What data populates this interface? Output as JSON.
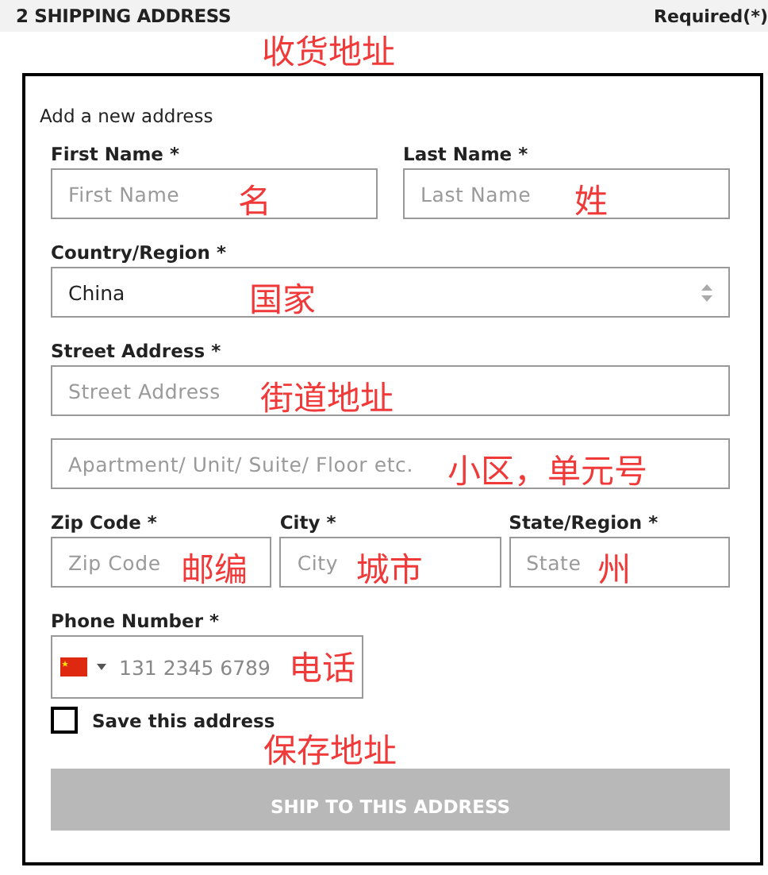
{
  "header": {
    "title": "2 SHIPPING ADDRESS",
    "required_note": "Required(*)"
  },
  "heading_note": "收货地址",
  "form": {
    "title": "Add a new address",
    "rows": [
      [
        {
          "kind": "text",
          "label": "First Name *",
          "placeholder": "First Name",
          "note": "名"
        },
        {
          "kind": "text",
          "label": "Last Name *",
          "placeholder": "Last Name",
          "note": "姓"
        }
      ],
      [
        {
          "kind": "select",
          "label": "Country/Region *",
          "value": "China",
          "note": "国家"
        }
      ],
      [
        {
          "kind": "text",
          "label": "Street Address *",
          "placeholder": "Street Address",
          "note": "街道地址"
        }
      ],
      [
        {
          "kind": "text",
          "placeholder": "Apartment/ Unit/ Suite/ Floor etc.",
          "note": "小区，单元号"
        }
      ],
      [
        {
          "kind": "text",
          "label": "Zip Code *",
          "placeholder": "Zip Code",
          "note": "邮编"
        },
        {
          "kind": "text",
          "label": "City *",
          "placeholder": "City",
          "note": "城市"
        },
        {
          "kind": "text",
          "label": "State/Region *",
          "placeholder": "State",
          "note": "州"
        }
      ],
      [
        {
          "kind": "phone",
          "label": "Phone Number *",
          "placeholder": "131 2345 6789",
          "note": "电话"
        }
      ]
    ],
    "save": {
      "label": "Save this address",
      "checked": false,
      "note": "保存地址"
    },
    "button": {
      "label": "SHIP TO THIS ADDRESS",
      "disabled": true
    }
  }
}
